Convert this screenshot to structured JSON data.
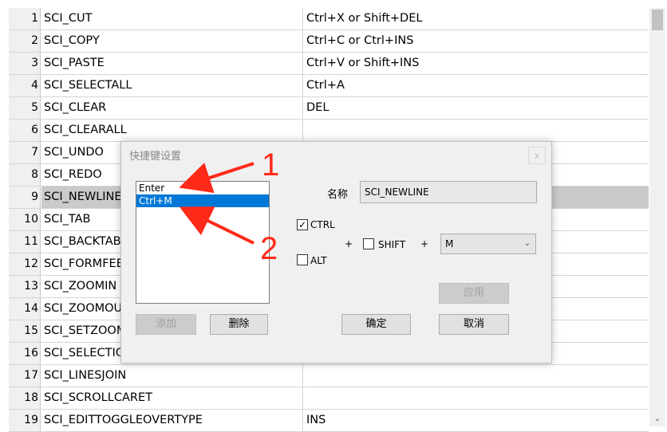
{
  "grid": {
    "rows": [
      {
        "num": "1",
        "name": "SCI_CUT",
        "key": "Ctrl+X or Shift+DEL"
      },
      {
        "num": "2",
        "name": "SCI_COPY",
        "key": "Ctrl+C or Ctrl+INS"
      },
      {
        "num": "3",
        "name": "SCI_PASTE",
        "key": "Ctrl+V or Shift+INS"
      },
      {
        "num": "4",
        "name": "SCI_SELECTALL",
        "key": "Ctrl+A"
      },
      {
        "num": "5",
        "name": "SCI_CLEAR",
        "key": "DEL"
      },
      {
        "num": "6",
        "name": "SCI_CLEARALL",
        "key": ""
      },
      {
        "num": "7",
        "name": "SCI_UNDO",
        "key": ""
      },
      {
        "num": "8",
        "name": "SCI_REDO",
        "key": ""
      },
      {
        "num": "9",
        "name": "SCI_NEWLINE",
        "key": ""
      },
      {
        "num": "10",
        "name": "SCI_TAB",
        "key": ""
      },
      {
        "num": "11",
        "name": "SCI_BACKTAB",
        "key": ""
      },
      {
        "num": "12",
        "name": "SCI_FORMFEED",
        "key": ""
      },
      {
        "num": "13",
        "name": "SCI_ZOOMIN",
        "key": ""
      },
      {
        "num": "14",
        "name": "SCI_ZOOMOUT",
        "key": ""
      },
      {
        "num": "15",
        "name": "SCI_SETZOOM",
        "key": ""
      },
      {
        "num": "16",
        "name": "SCI_SELECTIONDUPLICATE",
        "key": ""
      },
      {
        "num": "17",
        "name": "SCI_LINESJOIN",
        "key": ""
      },
      {
        "num": "18",
        "name": "SCI_SCROLLCARET",
        "key": ""
      },
      {
        "num": "19",
        "name": "SCI_EDITTOGGLEOVERTYPE",
        "key": "INS"
      }
    ],
    "selected_row": "9"
  },
  "dialog": {
    "title": "快捷键设置",
    "close_glyph": "x",
    "list_items": [
      "Enter",
      "Ctrl+M"
    ],
    "selected_item": "Ctrl+M",
    "name_label": "名称",
    "name_value": "SCI_NEWLINE",
    "ctrl_label": "CTRL",
    "ctrl_checked": true,
    "alt_label": "ALT",
    "alt_checked": false,
    "shift_label": "SHIFT",
    "shift_checked": false,
    "plus1": "+",
    "plus2": "+",
    "key_value": "M",
    "apply_label": "应用",
    "add_label": "添加",
    "delete_label": "删除",
    "ok_label": "确定",
    "cancel_label": "取消"
  },
  "annotations": {
    "marker1": "1",
    "marker2": "2",
    "color": "#ff2a1a"
  }
}
